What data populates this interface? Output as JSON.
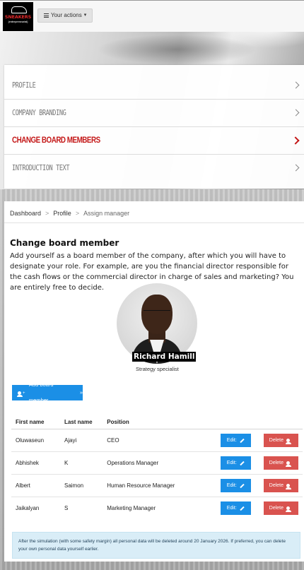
{
  "header": {
    "logo_brand": "SNEAKERS",
    "logo_tagline": "(entrepreneurial)",
    "actions_label": "Your actions",
    "actions_icon": "menu-bars-icon",
    "caret": "▾"
  },
  "menu": {
    "items": [
      {
        "label": "PROFILE",
        "active": false
      },
      {
        "label": "COMPANY BRANDING",
        "active": false
      },
      {
        "label": "CHANGE BOARD MEMBERS",
        "active": true
      },
      {
        "label": "INTRODUCTION TEXT",
        "active": false
      }
    ],
    "active_color": "#c41818"
  },
  "breadcrumb": {
    "items": [
      "Dashboard",
      "Profile",
      "Assign manager"
    ],
    "separator": ">"
  },
  "main": {
    "title": "Change board member",
    "intro": "Add yourself as a board member of the company, after which you will have to designate your role. For example, are you the financial director responsible for the cash flows or the commercial director in charge of sales and marketing? You are entirely free to decide.",
    "profile": {
      "name": "Richard Hamill",
      "role": "Strategy specialist"
    },
    "add_button": {
      "label": "Add board member",
      "arrow": "»",
      "color": "#1b8fe6"
    }
  },
  "table": {
    "headers": [
      "First name",
      "Last name",
      "Position"
    ],
    "rows": [
      {
        "first": "Oluwaseun",
        "last": "Ajayi",
        "position": "CEO"
      },
      {
        "first": "Abhishek",
        "last": "K",
        "position": "Operations Manager"
      },
      {
        "first": "Albert",
        "last": "Saimon",
        "position": "Human Resource Manager"
      },
      {
        "first": "Jaikalyan",
        "last": "S",
        "position": "Marketing Manager"
      }
    ],
    "edit_label": "Edit:",
    "delete_label": "Delete",
    "delete_color": "#d9534f"
  },
  "notice": "After the simulation (with some safety margin) all personal data will be deleted around 20 January 2026. If preferred, you can delete your own personal data yourself earlier."
}
